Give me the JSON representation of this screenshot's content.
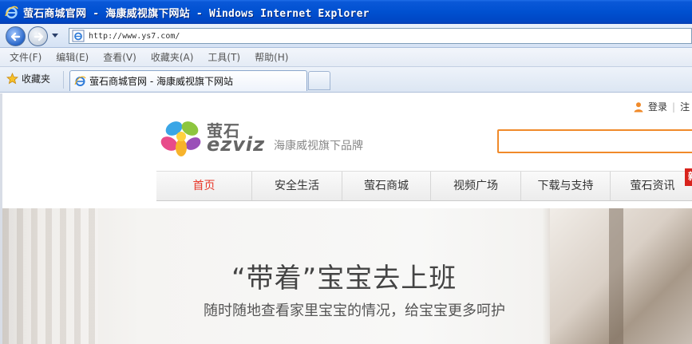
{
  "window": {
    "title": "萤石商城官网 - 海康威视旗下网站 - Windows Internet Explorer"
  },
  "address": {
    "url": "http://www.ys7.com/"
  },
  "menu": {
    "items": [
      "文件(F)",
      "编辑(E)",
      "查看(V)",
      "收藏夹(A)",
      "工具(T)",
      "帮助(H)"
    ]
  },
  "favorites": {
    "label": "收藏夹"
  },
  "tab": {
    "label": "萤石商城官网 - 海康威视旗下网站"
  },
  "site": {
    "login_label": "登录",
    "register_partial": "注",
    "logo": {
      "cn": "萤石",
      "en": "ezviz",
      "sub": "海康威视旗下品牌"
    },
    "nav": {
      "items": [
        "首页",
        "安全生活",
        "萤石商城",
        "视频广场",
        "下载与支持",
        "萤石资讯"
      ],
      "badge": "新"
    },
    "hero": {
      "headline": "“带着”宝宝去上班",
      "subline": "随时随地查看家里宝宝的情况，给宝宝更多呵护"
    }
  },
  "colors": {
    "titlebar": "#0050d0",
    "accent_nav": "#e8382a",
    "search_border": "#f08a2a",
    "badge": "#d8231c"
  }
}
